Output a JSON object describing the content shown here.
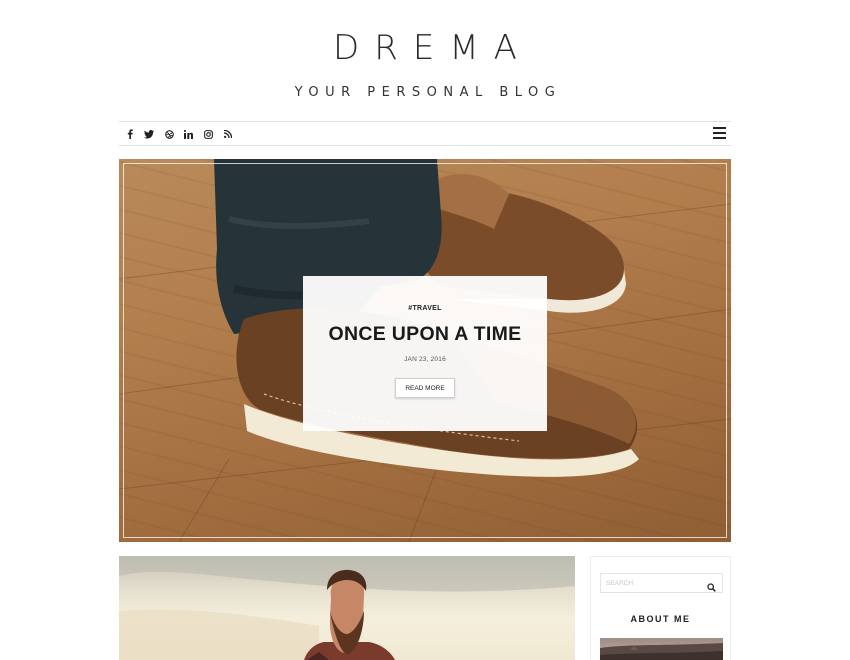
{
  "header": {
    "site_title": "DREMA",
    "tagline": "YOUR PERSONAL BLOG"
  },
  "topbar": {
    "social_icons": [
      "facebook-icon",
      "twitter-icon",
      "dribbble-icon",
      "linkedin-icon",
      "instagram-icon",
      "rss-icon"
    ],
    "menu_icon": "hamburger-menu-icon"
  },
  "featured_post": {
    "category": "#TRAVEL",
    "title": "ONCE UPON A TIME",
    "date": "JAN 23, 2016",
    "read_more_label": "READ MORE"
  },
  "sidebar": {
    "search_placeholder": "SEARCH",
    "search_icon": "search-icon",
    "about_title": "ABOUT ME"
  },
  "colors": {
    "text": "#1a1a1a",
    "border": "#e2e2e2",
    "hero_wood": "#b27d4c"
  }
}
